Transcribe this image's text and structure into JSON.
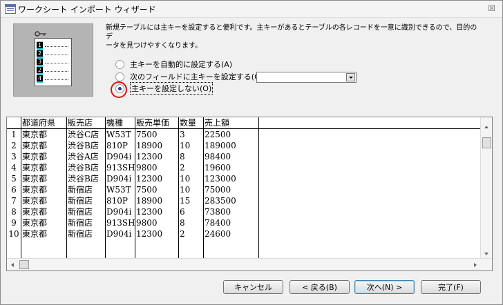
{
  "window": {
    "title": "ワークシート インポート ウィザード",
    "close_label": "☒"
  },
  "description": "新規テーブルには主キーを設定すると便利です。主キーがあるとテーブルの各レコードを一意に識別できるので、目的のデ\nータを見つけやすくなります。",
  "illustration": {
    "row_numbers": [
      "1",
      "2",
      "3",
      "2",
      "4"
    ],
    "cell_text": "xxx xxx xxx"
  },
  "options": [
    {
      "label": "主キーを自動的に設定する(A)",
      "selected": false
    },
    {
      "label": "次のフィールドに主キーを設定する(C)",
      "selected": false
    },
    {
      "label": "主キーを設定しない(O)",
      "selected": true
    }
  ],
  "key_field_select": {
    "value": ""
  },
  "table": {
    "columns": [
      "都道府県",
      "販売店",
      "機種",
      "販売単価",
      "数量",
      "売上額"
    ],
    "rows": [
      [
        "東京都",
        "渋谷C店",
        "W53T",
        "7500",
        "3",
        "22500"
      ],
      [
        "東京都",
        "渋谷B店",
        "810P",
        "18900",
        "10",
        "189000"
      ],
      [
        "東京都",
        "渋谷A店",
        "D904i",
        "12300",
        "8",
        "98400"
      ],
      [
        "東京都",
        "渋谷B店",
        "913SH",
        "9800",
        "2",
        "19600"
      ],
      [
        "東京都",
        "渋谷B店",
        "D904i",
        "12300",
        "10",
        "123000"
      ],
      [
        "東京都",
        "新宿店",
        "W53T",
        "7500",
        "10",
        "75000"
      ],
      [
        "東京都",
        "新宿店",
        "810P",
        "18900",
        "15",
        "283500"
      ],
      [
        "東京都",
        "新宿店",
        "D904i",
        "12300",
        "6",
        "73800"
      ],
      [
        "東京都",
        "新宿店",
        "913SH",
        "9800",
        "8",
        "78400"
      ],
      [
        "東京都",
        "新宿店",
        "D904i",
        "12300",
        "2",
        "24600"
      ]
    ],
    "row_numbers": [
      "1",
      "2",
      "3",
      "4",
      "5",
      "6",
      "7",
      "8",
      "9",
      "10"
    ]
  },
  "buttons": {
    "cancel": "キャンセル",
    "back": "< 戻る(B)",
    "next": "次へ(N) >",
    "finish": "完了(F)"
  }
}
